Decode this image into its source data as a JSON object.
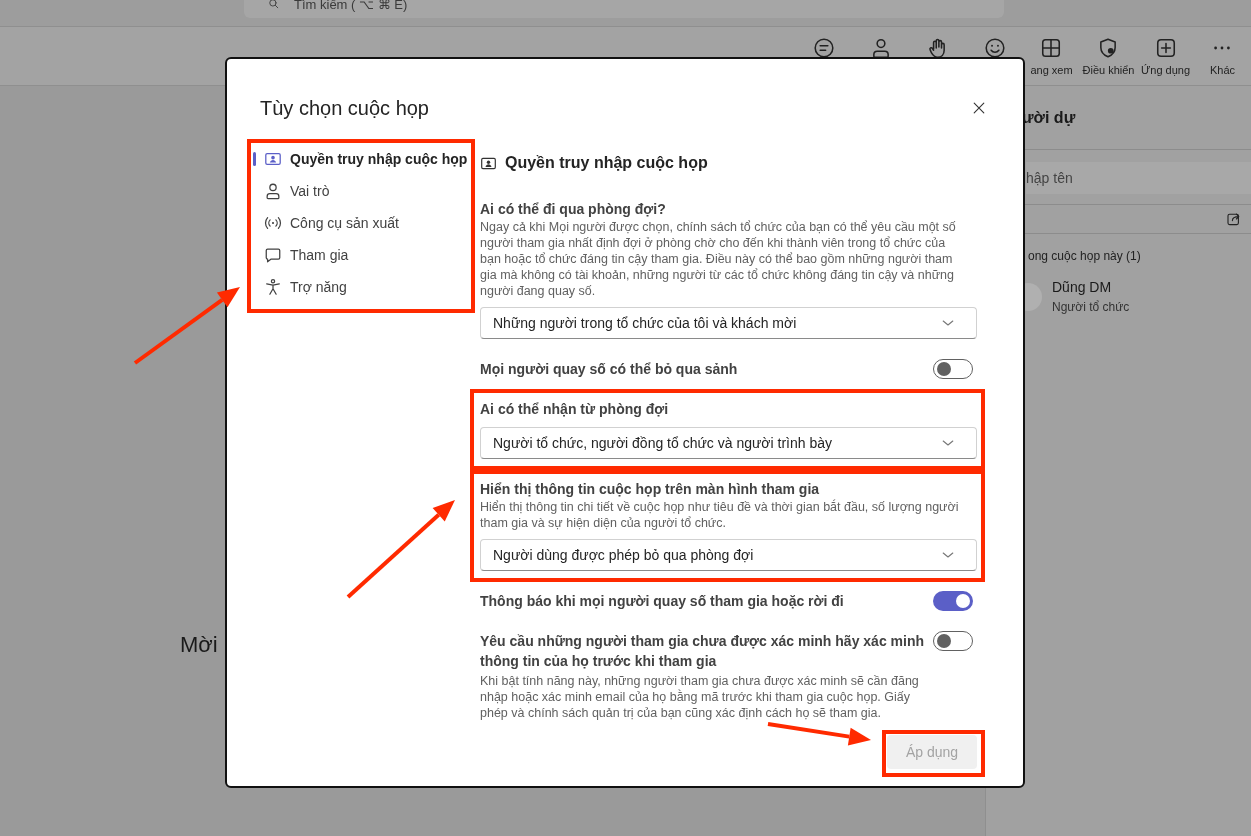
{
  "search": {
    "placeholder": "Tìm kiếm ( ⌥ ⌘ E)"
  },
  "toolbar": [
    {
      "kind": "chat"
    },
    {
      "kind": "person"
    },
    {
      "kind": "hand"
    },
    {
      "kind": "smile"
    },
    {
      "kind": "grid",
      "label": "ang xem"
    },
    {
      "kind": "shield",
      "label": "Điều khiển"
    },
    {
      "kind": "plus",
      "label": "Ứng dụng"
    },
    {
      "kind": "more",
      "label": "Khác"
    }
  ],
  "stage_text": "Mời",
  "side_panel": {
    "title": "ười dự",
    "search_placeholder": "hập tên",
    "section": "ong cuộc họp này (1)",
    "people": [
      {
        "name": "Dũng DM",
        "role": "Người tổ chức"
      }
    ]
  },
  "dialog": {
    "title": "Tùy chọn cuộc họp",
    "nav": [
      {
        "label": "Quyền truy nhập cuộc họp",
        "kind": "card",
        "selected": true
      },
      {
        "label": "Vai trò",
        "kind": "person",
        "selected": false
      },
      {
        "label": "Công cụ sản xuất",
        "kind": "broadcast",
        "selected": false
      },
      {
        "label": "Tham gia",
        "kind": "bubble",
        "selected": false
      },
      {
        "label": "Trợ năng",
        "kind": "accessibility",
        "selected": false
      }
    ],
    "section_title": "Quyền truy nhập cuộc họp",
    "settings": [
      {
        "kind": "dropdown",
        "label": "Ai có thể đi qua phòng đợi?",
        "description": "Ngay cả khi Mọi người được chọn, chính sách tổ chức của bạn có thể yêu cầu một số người tham gia nhất định đợi ở phòng chờ cho đến khi thành viên trong tổ chức của bạn hoặc tổ chức đáng tin cậy tham gia. Điều này có thể bao gồm những người tham gia mà không có tài khoản, những người từ các tổ chức không đáng tin cậy và những người đang quay số.",
        "value": "Những người trong tổ chức của tôi và khách mời"
      },
      {
        "kind": "toggle",
        "label": "Mọi người quay số có thể bỏ qua sảnh",
        "on": false
      },
      {
        "kind": "dropdown",
        "label": "Ai có thể nhận từ phòng đợi",
        "value": "Người tổ chức, người đồng tổ chức và người trình bày"
      },
      {
        "kind": "dropdown",
        "label": "Hiển thị thông tin cuộc họp trên màn hình tham gia",
        "description": "Hiển thị thông tin chi tiết về cuộc họp như tiêu đề và thời gian bắt đầu, số lượng người tham gia và sự hiện diện của người tổ chức.",
        "value": "Người dùng được phép bỏ qua phòng đợi"
      },
      {
        "kind": "toggle",
        "label": "Thông báo khi mọi người quay số tham gia hoặc rời đi",
        "on": true
      },
      {
        "kind": "toggle",
        "label": "Yêu cầu những người tham gia chưa được xác minh hãy xác minh thông tin của họ trước khi tham gia",
        "description": "Khi bật tính năng này, những người tham gia chưa được xác minh sẽ cần đăng nhập hoặc xác minh email của họ bằng mã trước khi tham gia cuộc họp. Giấy phép và chính sách quản trị của bạn cũng xác định cách họ sẽ tham gia.",
        "on": false
      }
    ],
    "apply": {
      "label": "Áp dụng",
      "disabled": true
    }
  }
}
